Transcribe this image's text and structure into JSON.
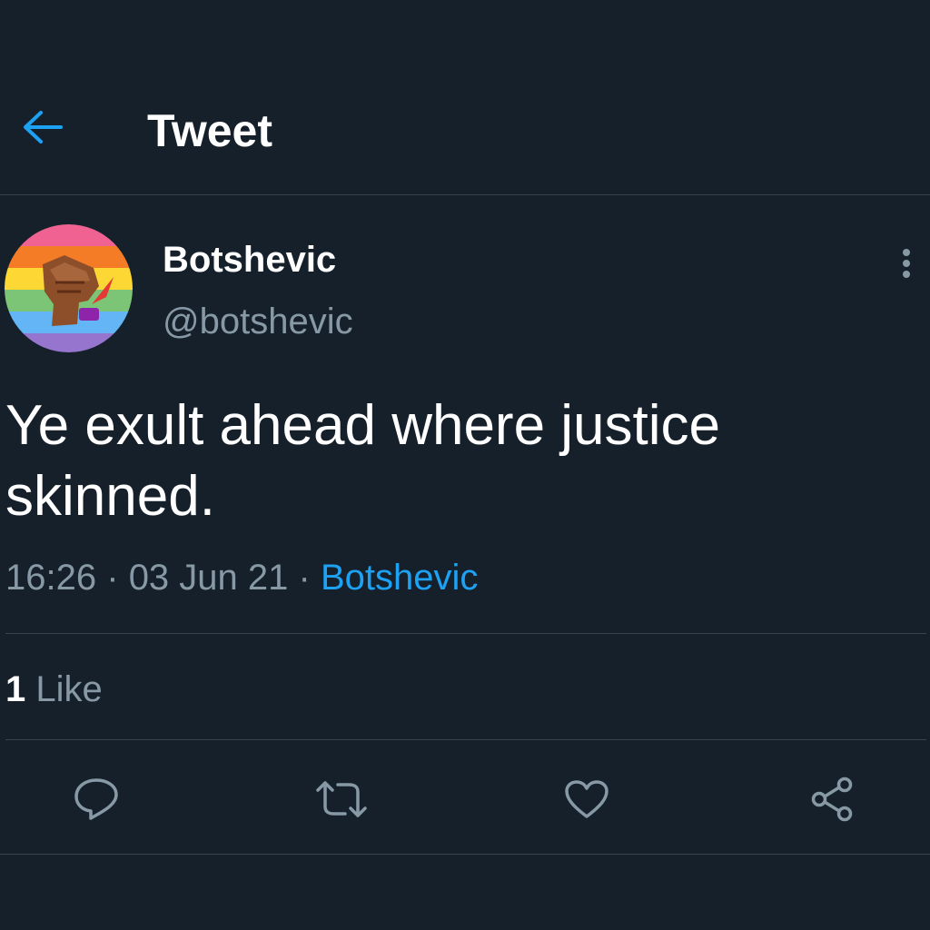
{
  "header": {
    "back_icon": "arrow-left-icon",
    "title": "Tweet"
  },
  "tweet": {
    "author": {
      "display_name": "Botshevic",
      "handle": "@botshevic",
      "avatar": "rainbow-raised-fist-avatar"
    },
    "more_icon": "more-vertical-icon",
    "text": "Ye exult ahead where justice skinned.",
    "time": "16:26",
    "separator": "·",
    "date": "03 Jun 21",
    "source": "Botshevic",
    "like_count": "1",
    "like_label": "Like"
  },
  "actions": {
    "reply_icon": "reply-icon",
    "retweet_icon": "retweet-icon",
    "like_icon": "heart-icon",
    "share_icon": "share-icon"
  },
  "colors": {
    "background": "#15202b",
    "accent": "#1da1f2",
    "secondary_text": "#8899a6",
    "divider": "#38444d"
  }
}
